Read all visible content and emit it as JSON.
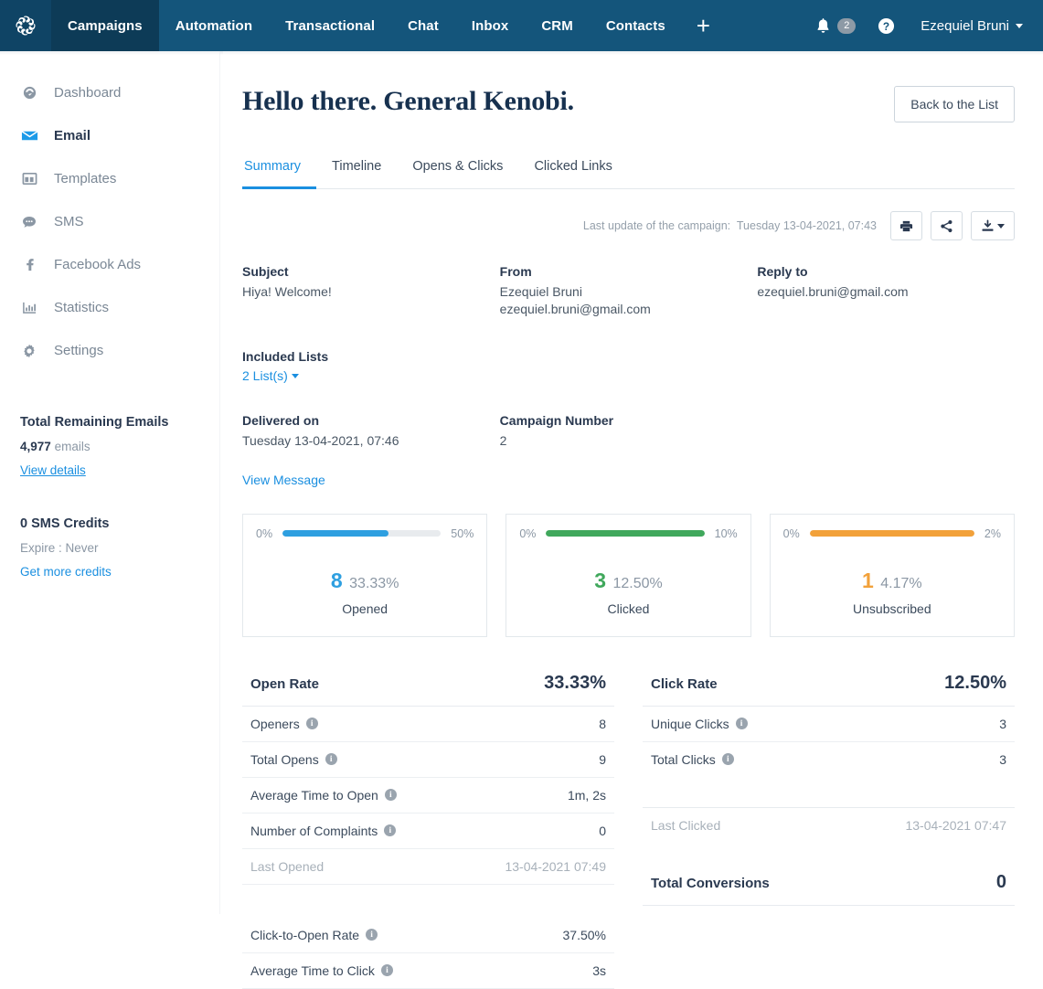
{
  "topnav": {
    "logo_icon": "pinwheel-logo",
    "items": [
      {
        "label": "Campaigns",
        "active": true
      },
      {
        "label": "Automation",
        "active": false
      },
      {
        "label": "Transactional",
        "active": false
      },
      {
        "label": "Chat",
        "active": false
      },
      {
        "label": "Inbox",
        "active": false
      },
      {
        "label": "CRM",
        "active": false
      },
      {
        "label": "Contacts",
        "active": false
      }
    ],
    "add_label": "+",
    "notification_count": "2",
    "bell_icon": "bell-icon",
    "help_icon": "question-circle-icon",
    "user_name": "Ezequiel Bruni"
  },
  "sidebar": {
    "items": [
      {
        "label": "Dashboard",
        "icon": "gauge-icon",
        "active": false
      },
      {
        "label": "Email",
        "icon": "envelope-icon",
        "active": true
      },
      {
        "label": "Templates",
        "icon": "layout-icon",
        "active": false
      },
      {
        "label": "SMS",
        "icon": "chat-bubble-icon",
        "active": false
      },
      {
        "label": "Facebook Ads",
        "icon": "facebook-icon",
        "active": false
      },
      {
        "label": "Statistics",
        "icon": "bar-chart-icon",
        "active": false
      },
      {
        "label": "Settings",
        "icon": "gear-icon",
        "active": false
      }
    ],
    "emails_block": {
      "title": "Total Remaining Emails",
      "amount": "4,977",
      "unit": "emails",
      "link": "View details"
    },
    "sms_block": {
      "title": "0 SMS Credits",
      "expire": "Expire : Never",
      "link": "Get more credits"
    }
  },
  "page": {
    "title": "Hello there. General Kenobi.",
    "back_button": "Back to the List"
  },
  "tabs": [
    {
      "label": "Summary",
      "active": true
    },
    {
      "label": "Timeline",
      "active": false
    },
    {
      "label": "Opens & Clicks",
      "active": false
    },
    {
      "label": "Clicked Links",
      "active": false
    }
  ],
  "update_row": {
    "label": "Last update of the campaign:",
    "value": "Tuesday 13-04-2021, 07:43",
    "print_icon": "printer-icon",
    "share_icon": "share-icon",
    "download_icon": "download-icon"
  },
  "meta": {
    "subject_label": "Subject",
    "subject_value": "Hiya! Welcome!",
    "from_label": "From",
    "from_name": "Ezequiel Bruni",
    "from_email": "ezequiel.bruni@gmail.com",
    "replyto_label": "Reply to",
    "replyto_value": "ezequiel.bruni@gmail.com",
    "lists_label": "Included Lists",
    "lists_value": "2 List(s)",
    "delivered_label": "Delivered on",
    "delivered_value": "Tuesday 13-04-2021, 07:46",
    "campaign_number_label": "Campaign Number",
    "campaign_number_value": "2",
    "view_message": "View Message"
  },
  "cards": [
    {
      "min": "0%",
      "max": "50%",
      "fill_pct": 67,
      "count": "8",
      "percent": "33.33%",
      "label": "Opened",
      "color": "#2e9fe0"
    },
    {
      "min": "0%",
      "max": "10%",
      "fill_pct": 100,
      "count": "3",
      "percent": "12.50%",
      "label": "Clicked",
      "color": "#40a85c"
    },
    {
      "min": "0%",
      "max": "2%",
      "fill_pct": 100,
      "count": "1",
      "percent": "4.17%",
      "label": "Unsubscribed",
      "color": "#f2a13a"
    }
  ],
  "open_rate": {
    "title": "Open Rate",
    "value": "33.33%",
    "rows": [
      {
        "label": "Openers",
        "info": true,
        "value": "8",
        "muted": false
      },
      {
        "label": "Total Opens",
        "info": true,
        "value": "9",
        "muted": false
      },
      {
        "label": "Average Time to Open",
        "info": true,
        "value": "1m, 2s",
        "muted": false
      },
      {
        "label": "Number of Complaints",
        "info": true,
        "value": "0",
        "muted": false
      },
      {
        "label": "Last Opened",
        "info": false,
        "value": "13-04-2021 07:49",
        "muted": true
      }
    ],
    "rows2": [
      {
        "label": "Click-to-Open Rate",
        "info": true,
        "value": "37.50%",
        "muted": false
      },
      {
        "label": "Average Time to Click",
        "info": true,
        "value": "3s",
        "muted": false
      }
    ]
  },
  "click_rate": {
    "title": "Click Rate",
    "value": "12.50%",
    "rows": [
      {
        "label": "Unique Clicks",
        "info": true,
        "value": "3",
        "muted": false
      },
      {
        "label": "Total Clicks",
        "info": true,
        "value": "3",
        "muted": false
      }
    ],
    "rows2": [
      {
        "label": "Last Clicked",
        "info": false,
        "value": "13-04-2021 07:47",
        "muted": true
      }
    ],
    "conversions_label": "Total Conversions",
    "conversions_value": "0"
  },
  "colors": {
    "nav_bg": "#14557b",
    "nav_active": "#0d3b57",
    "accent_blue": "#1a8fe0",
    "green": "#40a85c",
    "orange": "#f2a13a",
    "text_dark": "#2a3950"
  }
}
